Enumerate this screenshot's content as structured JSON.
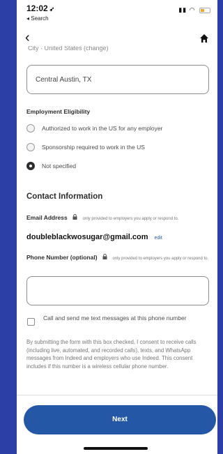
{
  "status_bar": {
    "time": "12:02",
    "back_label": "◂ Search"
  },
  "nav": {},
  "location": {
    "clipped_text": "City · United States (change)",
    "value": "Central Austin, TX"
  },
  "eligibility": {
    "title": "Employment Eligibility",
    "options": [
      {
        "label": "Authorized to work in the US for any employer",
        "selected": false
      },
      {
        "label": "Sponsorship required to work in the US",
        "selected": false
      },
      {
        "label": "Not specified",
        "selected": true
      }
    ]
  },
  "contact": {
    "title": "Contact Information",
    "email_label": "Email Address",
    "email_note": "only provided to employers you apply or respond to.",
    "email_value": "doubleblackwosugar@gmail.com",
    "edit_label": "edit",
    "phone_label": "Phone Number (optional)",
    "phone_note": "only provided to employers you apply or respond to.",
    "phone_value": "",
    "sms_label": "Call and send me text messages at this phone number",
    "consent_text": "By submitting the form with this box checked, I consent to receive calls (including live, automated, and recorded calls), texts, and WhatsApp messages from Indeed and employers who use Indeed. This consent includes if this number is a wireless cellular phone number."
  },
  "footer": {
    "next_label": "Next"
  }
}
